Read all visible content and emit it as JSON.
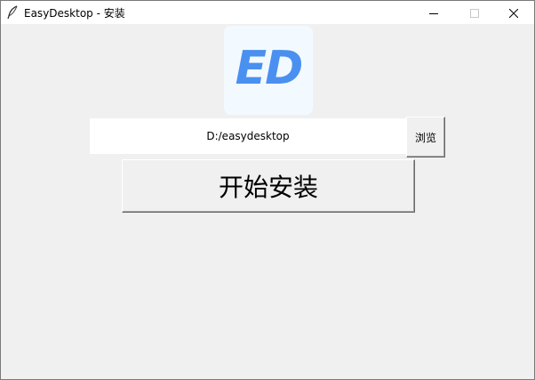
{
  "window": {
    "title": "EasyDesktop - 安装",
    "app_icon": "feather-icon",
    "controls": {
      "minimize_icon": "minimize-icon",
      "maximize_icon": "maximize-icon",
      "close_icon": "close-icon"
    }
  },
  "logo": {
    "text": "ED",
    "color": "#4a90f0",
    "background": "#f3faff"
  },
  "install_form": {
    "path_value": "D:/easydesktop",
    "browse_label": "浏览",
    "install_label": "开始安装"
  }
}
